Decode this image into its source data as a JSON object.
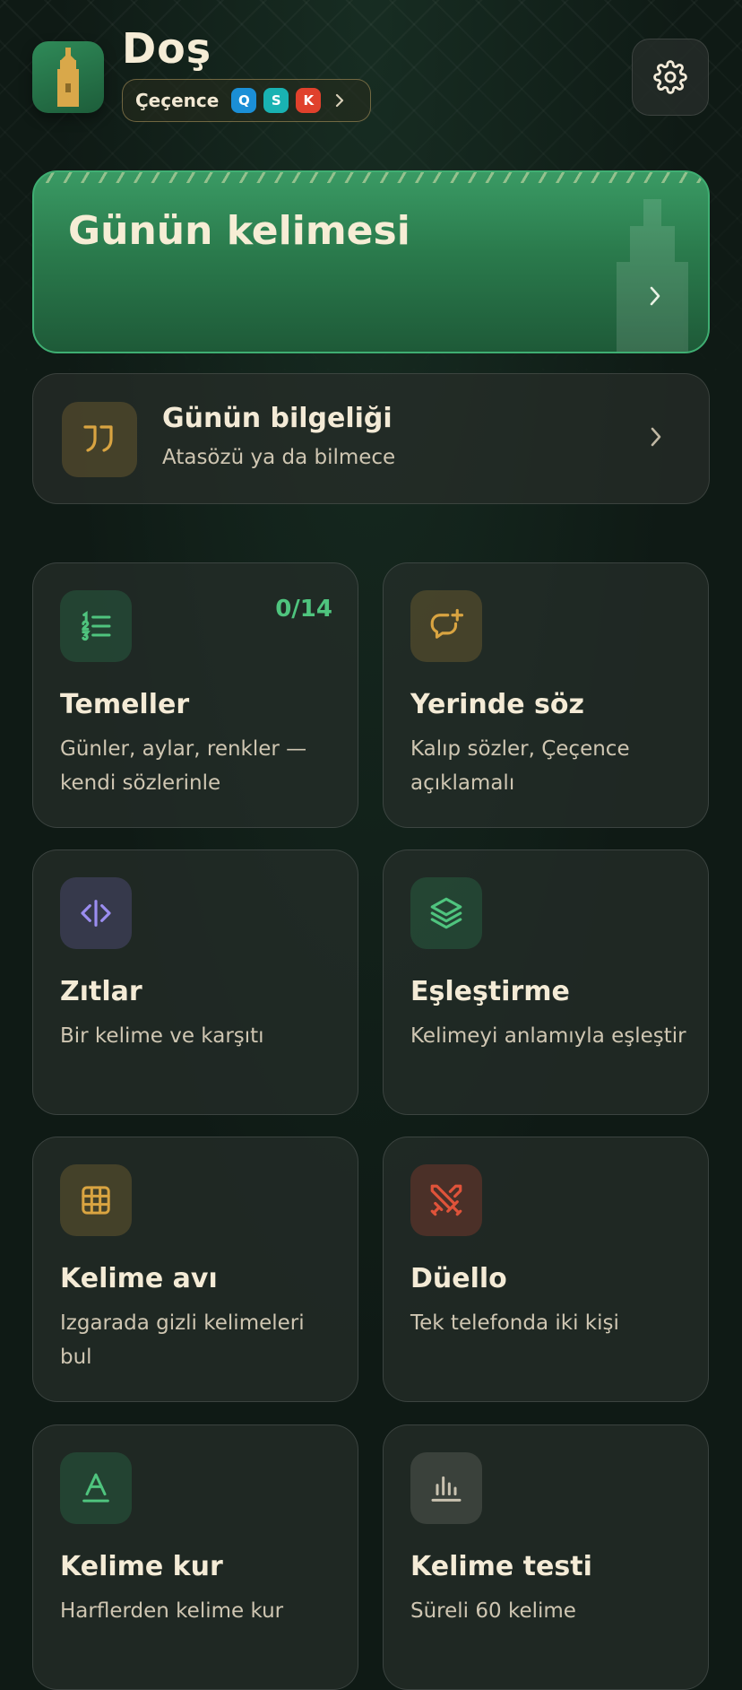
{
  "header": {
    "title": "Doş",
    "language": {
      "label": "Çeçence",
      "badges": [
        "Q",
        "S",
        "K"
      ]
    }
  },
  "word_of_day": {
    "title": "Günün kelimesi"
  },
  "wisdom": {
    "title": "Günün bilgeliği",
    "subtitle": "Atasözü ya da bilmece"
  },
  "cards": [
    {
      "title": "Temeller",
      "desc": "Günler, aylar, renkler — kendi sözlerinle",
      "count": "0/14",
      "icon": "list-numbered-icon"
    },
    {
      "title": "Yerinde söz",
      "desc": "Kalıp sözler, Çeçence açıklamalı",
      "icon": "chat-plus-icon"
    },
    {
      "title": "Zıtlar",
      "desc": "Bir kelime ve karşıtı",
      "icon": "opposites-icon"
    },
    {
      "title": "Eşleştirme",
      "desc": "Kelimeyi anlamıyla eşleştir",
      "icon": "layers-icon"
    },
    {
      "title": "Kelime avı",
      "desc": "Izgarada gizli kelimeleri bul",
      "icon": "grid-icon"
    },
    {
      "title": "Düello",
      "desc": "Tek telefonda iki kişi",
      "icon": "crossed-swords-icon"
    },
    {
      "title": "Kelime kur",
      "desc": "Harflerden kelime kur",
      "icon": "letter-a-icon"
    },
    {
      "title": "Kelime testi",
      "desc": "Süreli 60 kelime",
      "icon": "bar-chart-icon"
    }
  ],
  "colors": {
    "accent_green": "#3fae72",
    "counter_green": "#4fc47e",
    "amber": "#d9a441",
    "background": "#0f1a15"
  }
}
